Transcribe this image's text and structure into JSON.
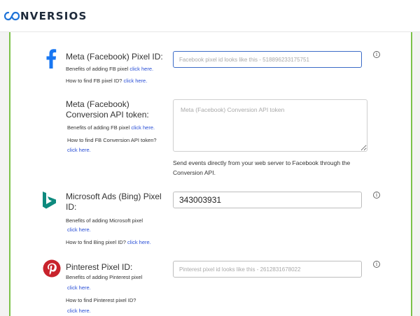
{
  "brand": {
    "name": "NVERSIOS"
  },
  "facebook": {
    "title": "Meta (Facebook) Pixel ID:",
    "benefits_text": "Benefits of adding FB pixel",
    "benefits_link": "click here.",
    "howto_text": "How to find FB pixel ID?",
    "howto_link": "click here.",
    "placeholder": "Facebook pixel id looks like this - 518896233175751",
    "value": ""
  },
  "capi": {
    "title_line1": "Meta (Facebook)",
    "title_line2": "Conversion API token:",
    "benefits_text": "Benefits of adding FB pixel",
    "benefits_link": "click here.",
    "howto_text": "How to find FB Conversion API token?",
    "howto_link": "click here.",
    "placeholder": "Meta (Facebook) Conversion API token",
    "description": "Send events directly from your web server to Facebook through the Conversion API."
  },
  "bing": {
    "title_line1": "Microsoft Ads (Bing) Pixel",
    "title_line2": "ID:",
    "benefits_text": "Benefits of adding Microsoft pixel",
    "benefits_link": "click here.",
    "howto_text": "How to find Bing pixel ID?",
    "howto_link": "click here.",
    "value": "343003931"
  },
  "pinterest": {
    "title": "Pinterest Pixel ID:",
    "benefits_text": "Benefits of adding Pinterest pixel",
    "benefits_link": "click here.",
    "howto_text": "How to find Pinterest pixel ID?",
    "howto_link": "click here.",
    "placeholder": "Pinterest pixel id looks like this - 2612831678022",
    "value": ""
  },
  "info_glyph": "i",
  "colors": {
    "accent": "#7cc24a",
    "link": "#2a4fd6",
    "facebook": "#1877f2",
    "bing": "#0e8a7e",
    "pinterest": "#c8232c"
  }
}
